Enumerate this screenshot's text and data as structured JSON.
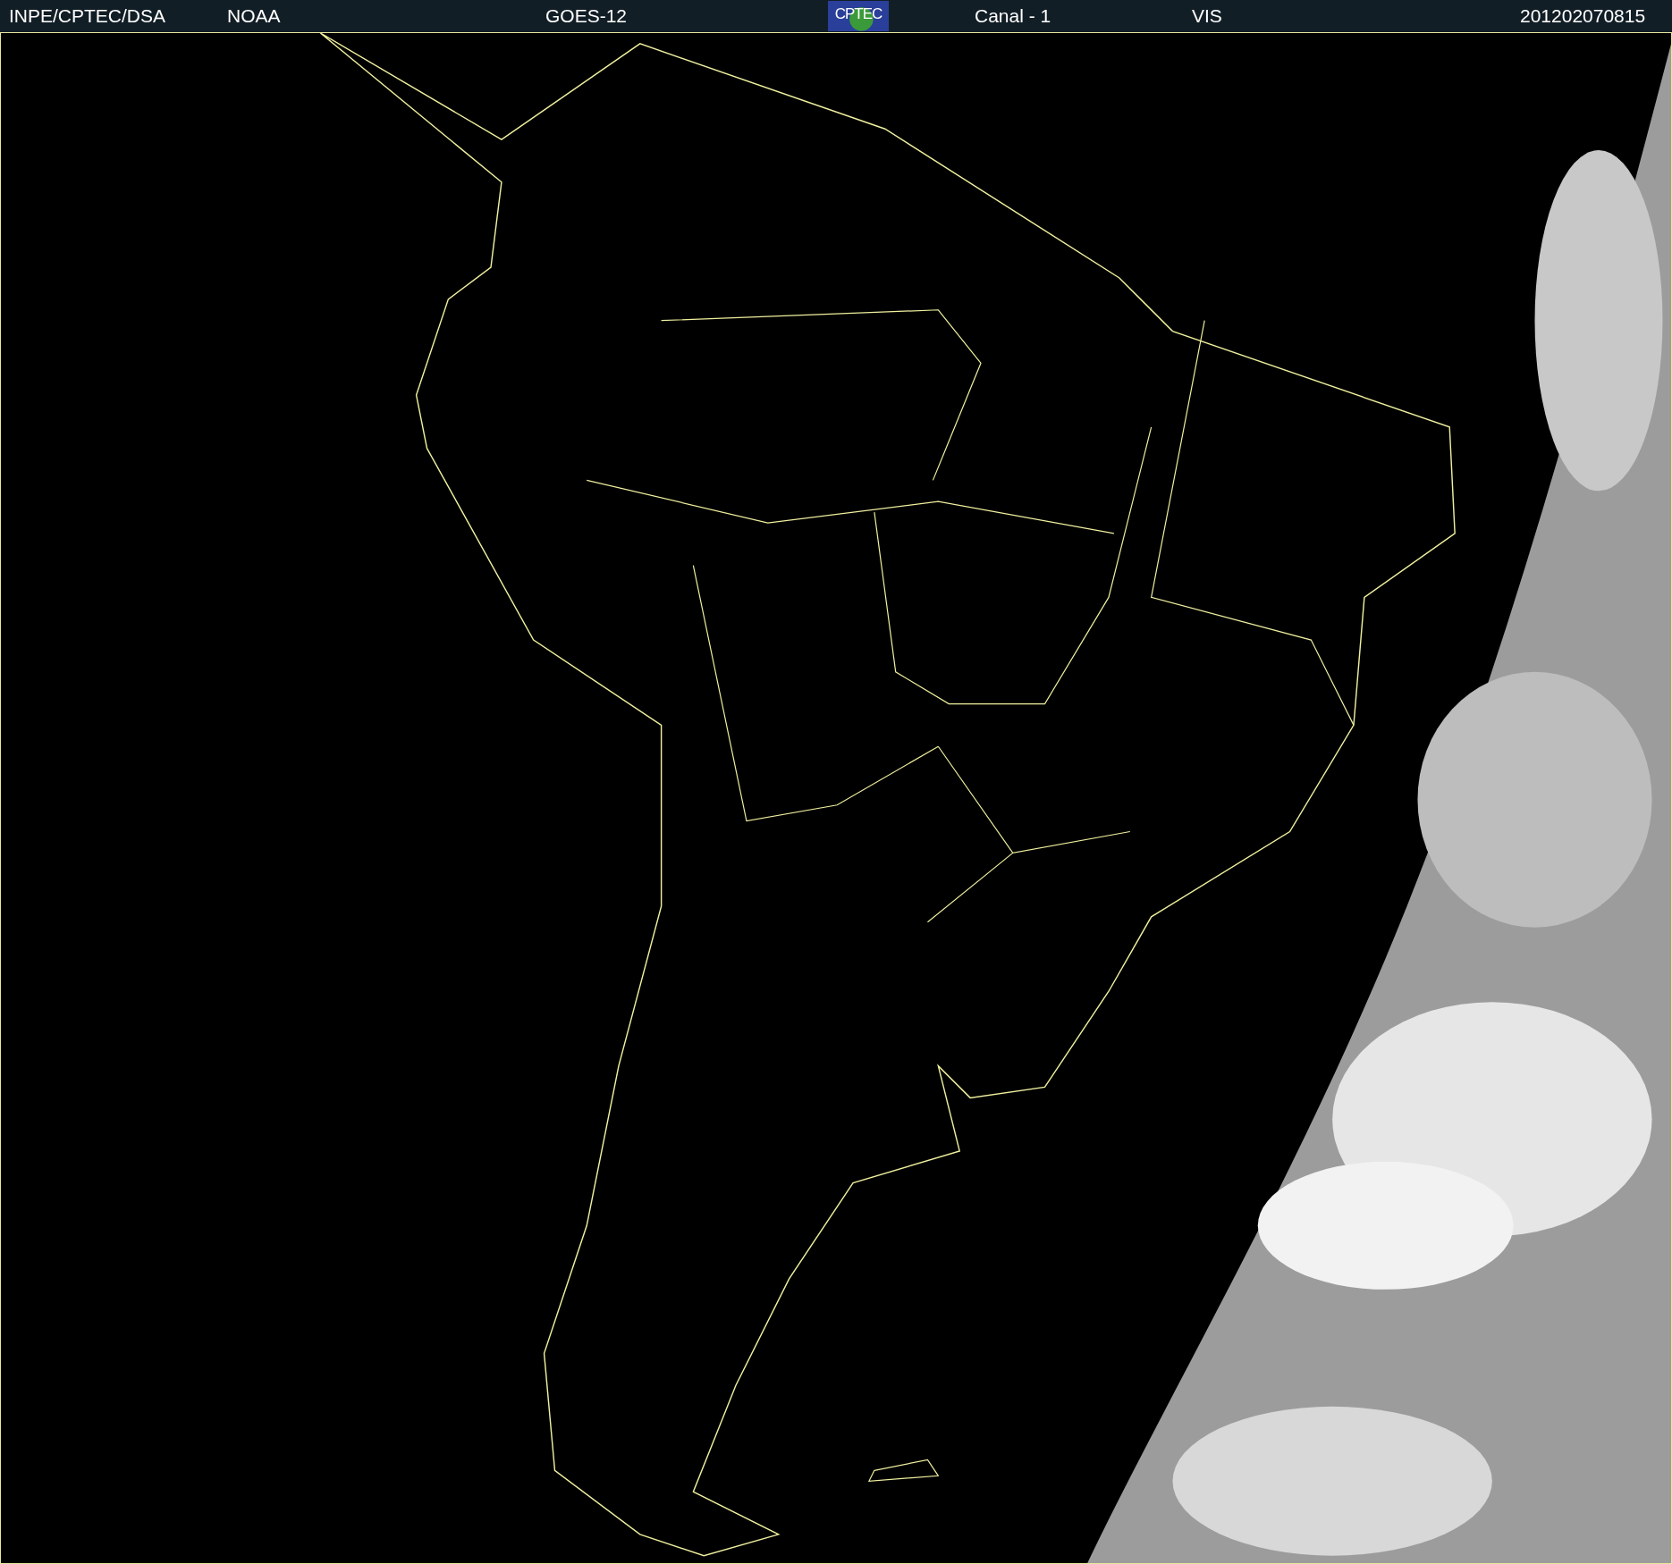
{
  "header": {
    "items": [
      {
        "kind": "text",
        "text": "INPE/CPTEC/DSA"
      },
      {
        "kind": "text",
        "text": "NOAA"
      },
      {
        "kind": "text",
        "text": "GOES-12"
      },
      {
        "kind": "logo",
        "text": "CPTEC"
      },
      {
        "kind": "text",
        "text": "Canal - 1"
      },
      {
        "kind": "text",
        "text": "VIS"
      },
      {
        "kind": "text",
        "text": "201202070815"
      }
    ]
  }
}
